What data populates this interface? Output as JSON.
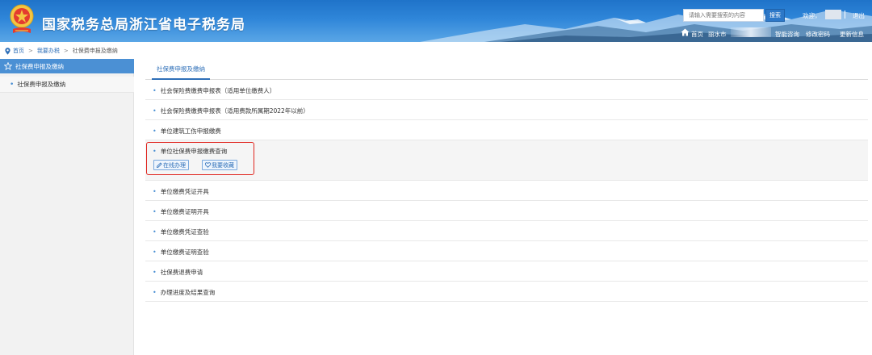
{
  "header": {
    "site_title": "国家税务总局浙江省电子税务局",
    "search_placeholder": "请输入需要搜索的内容",
    "search_button": "搜索",
    "welcome": "欢迎，",
    "logout": "退出",
    "nav": {
      "home": "首页",
      "city": "丽水市",
      "smart_consult": "智能咨询",
      "change_password": "修改密码",
      "update_info": "更新信息"
    }
  },
  "breadcrumb": {
    "items": [
      "首页",
      "我要办税",
      "社保费申报及缴纳"
    ],
    "separator": ">"
  },
  "sidebar": {
    "header": "社保费申报及缴纳",
    "items": [
      {
        "label": "社保费申报及缴纳"
      }
    ]
  },
  "main": {
    "tab": "社保费申报及缴纳",
    "list": [
      {
        "label": "社会保险费缴费申报表（适用单位缴费人）"
      },
      {
        "label": "社会保险费缴费申报表（适用费款所属期2022年以前）"
      },
      {
        "label": "单位建筑工伤申报缴费"
      },
      {
        "label": "单位社保费申报缴费查询",
        "actions": {
          "online": "在线办理",
          "favorite": "我要收藏"
        }
      },
      {
        "label": "单位缴费凭证开具"
      },
      {
        "label": "单位缴费证明开具"
      },
      {
        "label": "单位缴费凭证查验"
      },
      {
        "label": "单位缴费证明查验"
      },
      {
        "label": "社保费退费申请"
      },
      {
        "label": "办理进度及结果查询"
      }
    ]
  },
  "colors": {
    "header_blue": "#2f86d9",
    "accent_blue": "#2e6fb8",
    "sidebar_head": "#4b90d4",
    "highlight_red": "#e0261f"
  },
  "icons": {
    "emblem": "tax-emblem-icon",
    "home": "home-icon",
    "pin": "location-pin-icon",
    "star": "star-icon",
    "edit": "pencil-icon",
    "favorite": "heart-icon"
  }
}
